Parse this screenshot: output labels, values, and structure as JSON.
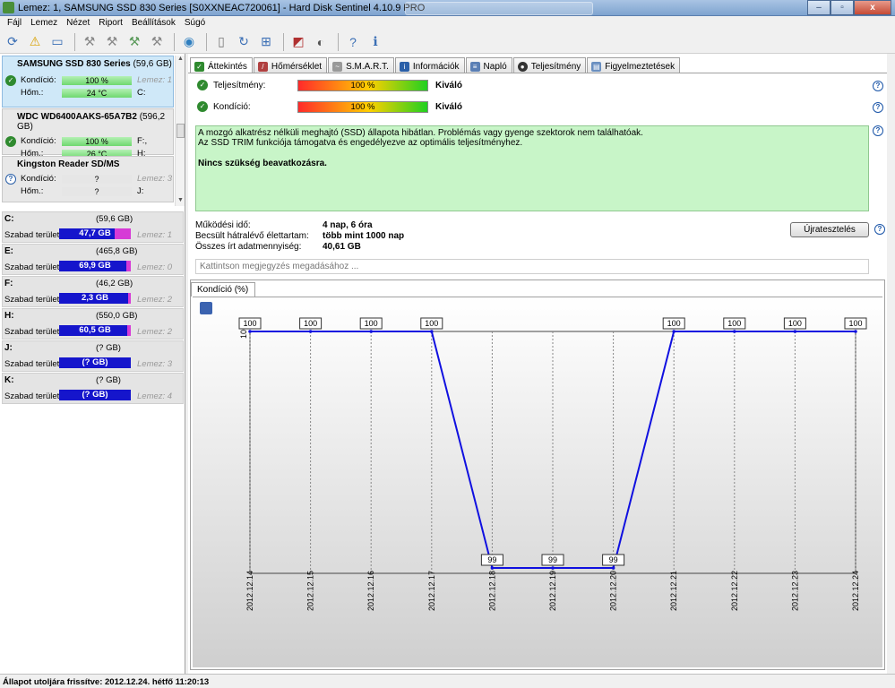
{
  "window": {
    "title": "Lemez: 1, SAMSUNG SSD 830 Series [S0XXNEAC720061]  -  Hard Disk Sentinel 4.10.9 PRO",
    "buttons": {
      "minimize": "–",
      "maximize": "▫",
      "close": "x"
    }
  },
  "menu": [
    "Fájl",
    "Lemez",
    "Nézet",
    "Riport",
    "Beállítások",
    "Súgó"
  ],
  "toolbar_icons": [
    "refresh-icon",
    "warning-icon",
    "disk-icon",
    "tool-icon",
    "tool-icon",
    "tool-check-icon",
    "tool-x-icon",
    "globe-icon",
    "document-icon",
    "sync-icon",
    "windows-icon",
    "chart-icon",
    "speaker-icon",
    "help-icon",
    "info-icon"
  ],
  "disks": [
    {
      "name": "SAMSUNG SSD 830 Series",
      "size": "(59,6 GB)",
      "condition_label": "Kondíció:",
      "condition": "100 %",
      "temp_label": "Hőm.:",
      "temp": "24 °C",
      "disk_no": "Lemez: 1",
      "drive": "C:",
      "status": "ok",
      "selected": true
    },
    {
      "name": "WDC WD6400AAKS-65A7B2",
      "size": "(596,2 GB)",
      "condition_label": "Kondíció:",
      "condition": "100 %",
      "temp_label": "Hőm.:",
      "temp": "26 °C",
      "disk_no": "F:,",
      "drive": "H:",
      "status": "ok",
      "selected": false
    },
    {
      "name": "Kingston Reader    SD/MS",
      "size": "",
      "condition_label": "Kondíció:",
      "condition": "?",
      "temp_label": "Hőm.:",
      "temp": "?",
      "disk_no": "Lemez: 3",
      "drive": "J:",
      "status": "unknown",
      "selected": false
    }
  ],
  "partitions": [
    {
      "letter": "C:",
      "size": "(59,6 GB)",
      "free_label": "Szabad terület",
      "free": "47,7 GB",
      "disk": "Lemez: 1",
      "used_fraction": 0.2
    },
    {
      "letter": "E:",
      "size": "(465,8 GB)",
      "free_label": "Szabad terület",
      "free": "69,9 GB",
      "disk": "Lemez: 0",
      "used_fraction": 0.85
    },
    {
      "letter": "F:",
      "size": "(46,2 GB)",
      "free_label": "Szabad terület",
      "free": "2,3 GB",
      "disk": "Lemez: 2",
      "used_fraction": 0.95
    },
    {
      "letter": "H:",
      "size": "(550,0 GB)",
      "free_label": "Szabad terület",
      "free": "60,5 GB",
      "disk": "Lemez: 2",
      "used_fraction": 0.89
    },
    {
      "letter": "J:",
      "size": "(? GB)",
      "free_label": "Szabad terület",
      "free": "(? GB)",
      "disk": "Lemez: 3",
      "used_fraction": 0
    },
    {
      "letter": "K:",
      "size": "(? GB)",
      "free_label": "Szabad terület",
      "free": "(? GB)",
      "disk": "Lemez: 4",
      "used_fraction": 0
    }
  ],
  "tabs": [
    "Áttekintés",
    "Hőmérséklet",
    "S.M.A.R.T.",
    "Információk",
    "Napló",
    "Teljesítmény",
    "Figyelmeztetések"
  ],
  "overview": {
    "performance_label": "Teljesítmény:",
    "performance_value": "100 %",
    "performance_verdict": "Kiváló",
    "condition_label": "Kondíció:",
    "condition_value": "100 %",
    "condition_verdict": "Kiváló",
    "message_line1": "A mozgó alkatrész nélküli meghajtó (SSD) állapota hibátlan. Problémás vagy gyenge szektorok nem találhatóak.",
    "message_line2": "Az SSD TRIM funkciója támogatva és engedélyezve az optimális teljesítményhez.",
    "message_bold": "Nincs szükség beavatkozásra.",
    "uptime_label": "Működési idő:",
    "uptime_value": "4 nap, 6 óra",
    "lifetime_label": "Becsült hátralévő élettartam:",
    "lifetime_value": "több mint 1000 nap",
    "written_label": "Összes írt adatmennyiség:",
    "written_value": "40,61 GB",
    "retest_button": "Újratesztelés",
    "note_placeholder": "Kattintson megjegyzés megadásához ..."
  },
  "chart_tab": "Kondíció  (%)",
  "chart_data": {
    "type": "line",
    "x": [
      "2012.12.14",
      "2012.12.15",
      "2012.12.16",
      "2012.12.17",
      "2012.12.18",
      "2012.12.19",
      "2012.12.20",
      "2012.12.21",
      "2012.12.22",
      "2012.12.23",
      "2012.12.24"
    ],
    "series": [
      {
        "values": [
          100,
          100,
          100,
          100,
          99,
          99,
          99,
          100,
          100,
          100,
          100
        ]
      }
    ],
    "ylim": [
      99,
      100
    ],
    "ytick": "100",
    "line_color": "#1010e0"
  },
  "status_bar": "Állapot utoljára frissítve: 2012.12.24. hétfő 11:20:13"
}
